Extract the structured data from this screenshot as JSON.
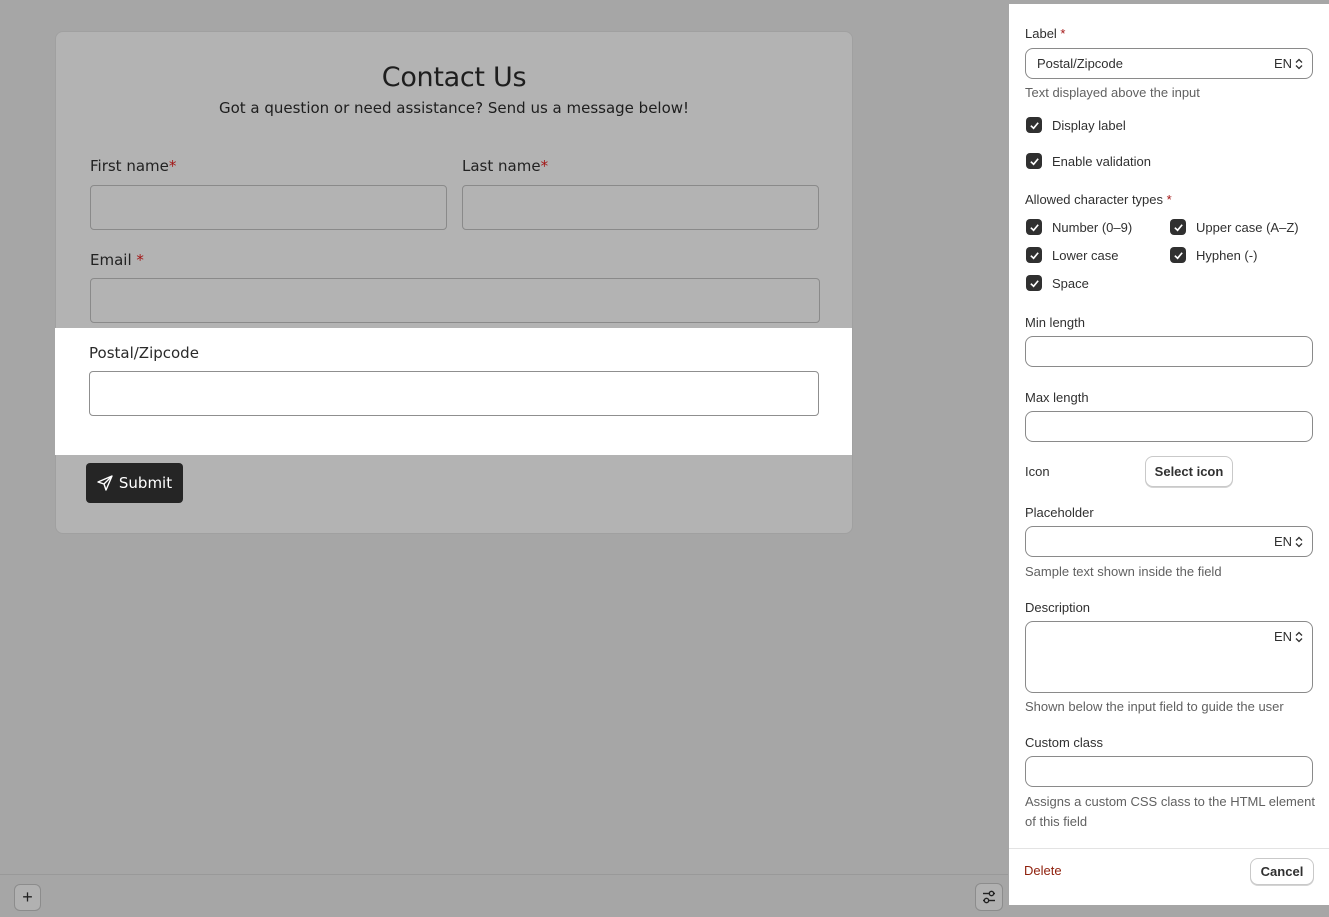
{
  "form": {
    "title": "Contact Us",
    "subtitle": "Got a question or need assistance? Send us a message below!",
    "first_name_label": "First name",
    "last_name_label": "Last name",
    "email_label": "Email ",
    "required_mark": "*",
    "postal_label": "Postal/Zipcode",
    "submit_label": "Submit"
  },
  "toolbar": {
    "add_label": "+"
  },
  "panel": {
    "label_field": {
      "label": "Label ",
      "required_mark": "*",
      "value": "Postal/Zipcode",
      "lang": "EN",
      "help": "Text displayed above the input"
    },
    "display_label": "Display label",
    "enable_validation": "Enable validation",
    "char_types": {
      "label": "Allowed character types ",
      "required_mark": "*",
      "options": [
        "Number (0–9)",
        "Upper case (A–Z)",
        "Lower case",
        "Hyphen (-)",
        "Space"
      ]
    },
    "min_length_label": "Min length",
    "min_length_value": "",
    "max_length_label": "Max length",
    "max_length_value": "",
    "icon_label": "Icon",
    "select_icon_label": "Select icon",
    "placeholder": {
      "label": "Placeholder",
      "value": "",
      "lang": "EN",
      "help": "Sample text shown inside the field"
    },
    "description": {
      "label": "Description",
      "value": "",
      "lang": "EN",
      "help": "Shown below the input field to guide the user"
    },
    "custom_class": {
      "label": "Custom class",
      "value": "",
      "help": "Assigns a custom CSS class to the HTML element of this field"
    },
    "delete_label": "Delete",
    "cancel_label": "Cancel"
  }
}
